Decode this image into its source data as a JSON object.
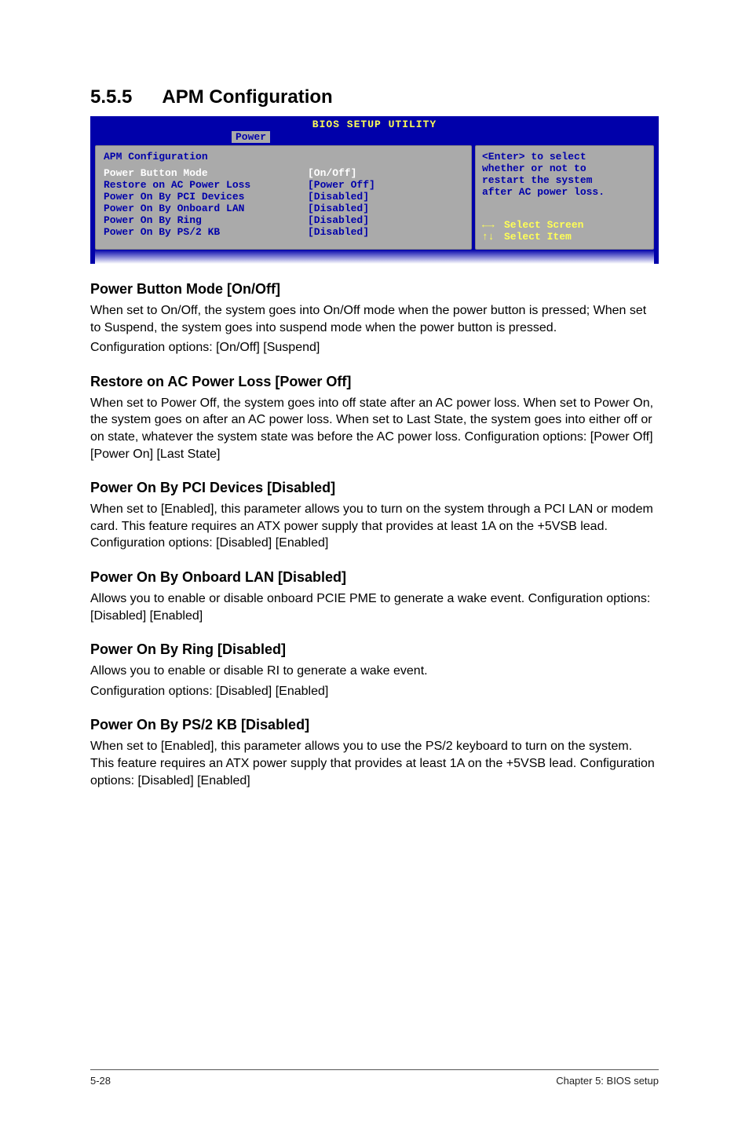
{
  "section": {
    "number": "5.5.5",
    "title": "APM Configuration"
  },
  "bios": {
    "app_title": "BIOS SETUP UTILITY",
    "tab": "Power",
    "panel_title": "APM Configuration",
    "rows": [
      {
        "k": "Power Button Mode",
        "v": "[On/Off]",
        "selected": true
      },
      {
        "k": "Restore on AC Power Loss",
        "v": "[Power Off]",
        "selected": false
      },
      {
        "k": "",
        "v": "",
        "selected": false
      },
      {
        "k": "Power On By PCI Devices",
        "v": "[Disabled]",
        "selected": false
      },
      {
        "k": "Power On By Onboard LAN",
        "v": "[Disabled]",
        "selected": false
      },
      {
        "k": "Power On By Ring",
        "v": "[Disabled]",
        "selected": false
      },
      {
        "k": "Power On By PS/2 KB",
        "v": "[Disabled]",
        "selected": false
      }
    ],
    "help_top1": "<Enter> to select",
    "help_top2": "whether or not to",
    "help_top3": "restart the system",
    "help_top4": "after AC power loss.",
    "nav1_sym": "←→",
    "nav1_txt": "Select Screen",
    "nav2_sym": "↑↓",
    "nav2_txt": "Select Item"
  },
  "sub": {
    "pbm_h": "Power Button Mode [On/Off]",
    "pbm_p1": "When set to On/Off, the system goes into On/Off mode when the power button is pressed; When set to Suspend, the system goes into suspend mode when the power button is pressed.",
    "pbm_p2": "Configuration options: [On/Off] [Suspend]",
    "rac_h": "Restore on AC Power Loss [Power Off]",
    "rac_p1": "When set to Power Off, the system goes into off state after an AC power loss. When set to Power On, the system goes on after an AC power loss. When set to Last State, the system goes into either off or on state, whatever the system state was before the AC power loss. Configuration options: [Power Off] [Power On] [Last State]",
    "pci_h": "Power On By PCI Devices [Disabled]",
    "pci_p1": "When set to [Enabled], this parameter allows you to turn on the system through a PCI LAN or modem card. This feature requires an ATX power supply that provides at least 1A on the +5VSB lead. Configuration options: [Disabled] [Enabled]",
    "lan_h": "Power On By Onboard LAN [Disabled]",
    "lan_p1": "Allows you to enable or disable onboard PCIE PME to generate a wake event. Configuration options: [Disabled] [Enabled]",
    "ring_h": "Power On By Ring [Disabled]",
    "ring_p1": "Allows you to enable or disable RI to generate a wake event.",
    "ring_p2": "Configuration options: [Disabled] [Enabled]",
    "ps2_h": "Power On By PS/2 KB [Disabled]",
    "ps2_p1": "When set to [Enabled], this parameter allows you to use the PS/2 keyboard to turn on the system. This feature requires an ATX power supply that provides at least 1A on the +5VSB lead. Configuration options: [Disabled] [Enabled]"
  },
  "footer": {
    "left": "5-28",
    "right": "Chapter 5: BIOS setup"
  }
}
